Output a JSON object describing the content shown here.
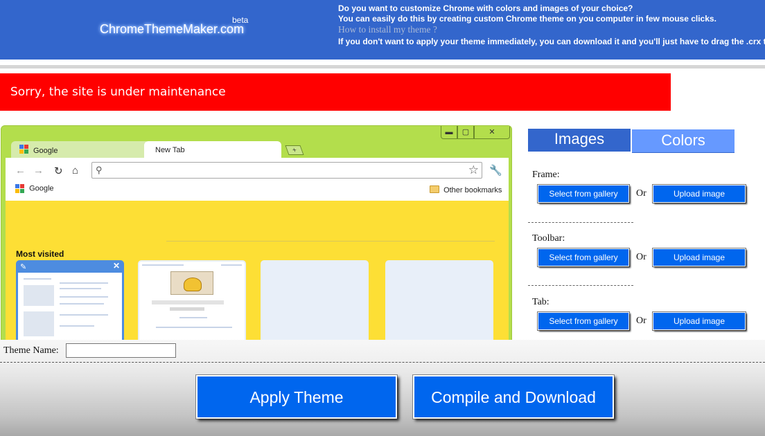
{
  "header": {
    "logo_text": "ChromeThemeMaker.com",
    "logo_beta": "beta",
    "intro_line1": "Do you want to customize Chrome with colors and images of your choice?",
    "intro_line2": "You can easily do this by creating custom Chrome theme on you computer in few mouse clicks.",
    "howto_link": "How to install my theme ?",
    "intro_line3": "If you don't want to apply your theme immediately, you can download it and you'll just have to drag the .crx theme on"
  },
  "banner": {
    "text": "Sorry, the site is under maintenance",
    "color": "#ff0000"
  },
  "preview": {
    "tabs": [
      {
        "label": "Google"
      },
      {
        "label": "New Tab"
      }
    ],
    "bookmarks": {
      "google_label": "Google",
      "other_label": "Other bookmarks"
    },
    "most_visited_label": "Most visited",
    "frame_color": "#b3de4c",
    "ntp_color": "#fddf35"
  },
  "panel": {
    "tab_images": "Images",
    "tab_colors": "Colors",
    "sections": [
      {
        "label": "Frame:",
        "gallery": "Select from gallery",
        "or": "Or",
        "upload": "Upload image"
      },
      {
        "label": "Toolbar:",
        "gallery": "Select from gallery",
        "or": "Or",
        "upload": "Upload image"
      },
      {
        "label": "Tab:",
        "gallery": "Select from gallery",
        "or": "Or",
        "upload": "Upload image"
      }
    ]
  },
  "bottom": {
    "theme_name_label": "Theme Name:",
    "theme_name_value": "",
    "apply_label": "Apply Theme",
    "compile_label": "Compile and Download"
  },
  "colors": {
    "header_blue": "#3366cc",
    "button_blue": "#0066ee",
    "tab_colors_blue": "#6699ff"
  }
}
